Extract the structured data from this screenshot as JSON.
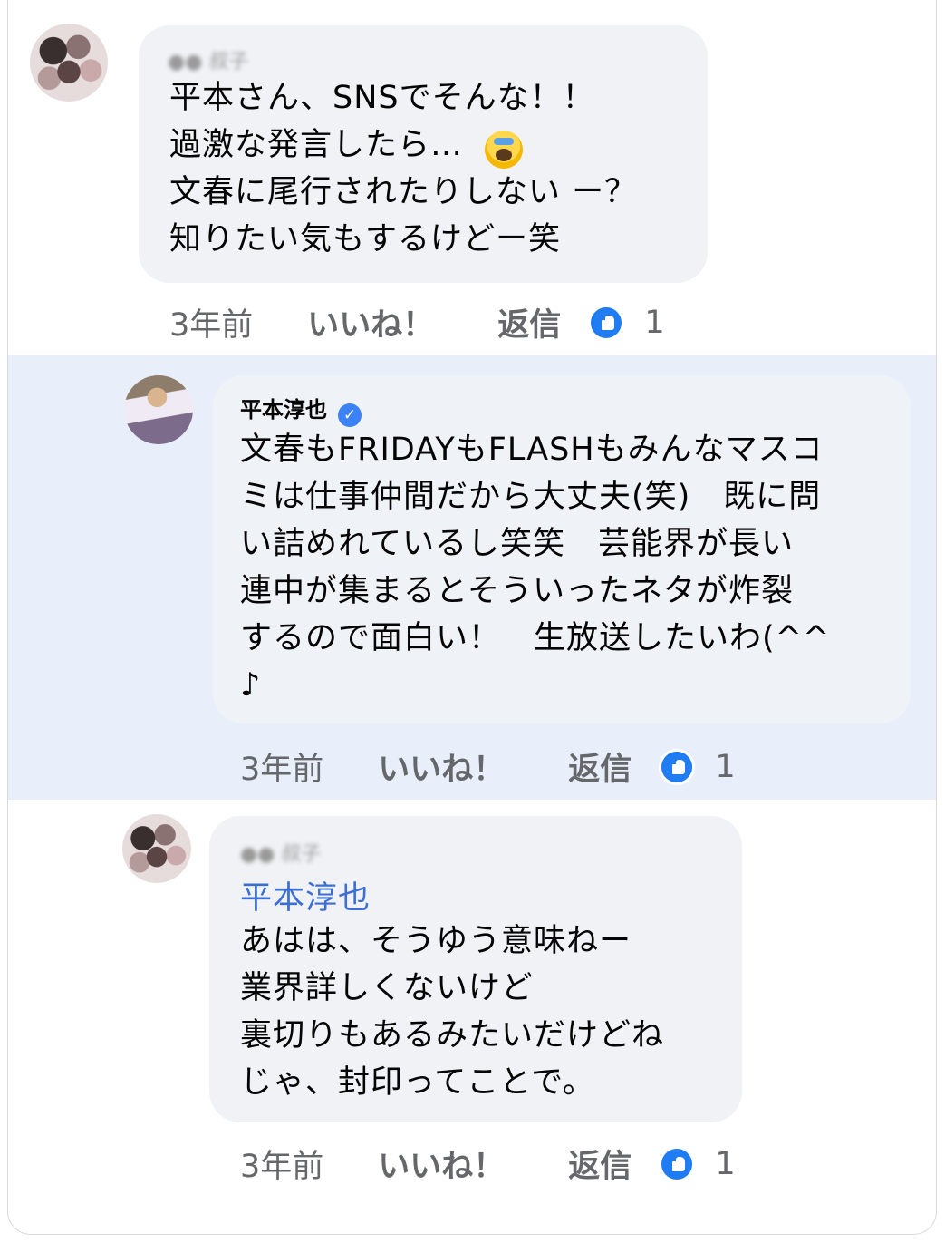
{
  "comments": [
    {
      "author": "●● 叔子",
      "text": "平本さん、SNSでそんな！！\n過激な発言したら…\n文春に尾行されたりしない ー？\n知りたい気もするけどー笑",
      "emoji": "face-screaming-in-fear",
      "time": "3年前",
      "like_label": "いいね！",
      "reply_label": "返信",
      "like_count": "1"
    },
    {
      "author": "平本淳也",
      "verified": true,
      "text": "文春もFRIDAYもFLASHもみんなマスコ\nミは仕事仲間だから大丈夫(笑)　既に問\nい詰めれているし笑笑　芸能界が長い\n連中が集まるとそういったネタが炸裂\nするので面白い！　生放送したいわ(^^\n♪",
      "time": "3年前",
      "like_label": "いいね！",
      "reply_label": "返信",
      "like_count": "1"
    },
    {
      "author": "●● 叔子",
      "mention": "平本淳也",
      "text": "あはは、そうゆう意味ねー\n業界詳しくないけど\n裏切りもあるみたいだけどね\nじゃ、封印ってことで。",
      "time": "3年前",
      "like_label": "いいね！",
      "reply_label": "返信",
      "like_count": "1"
    }
  ],
  "colors": {
    "highlight": "#e9effa",
    "bubble": "#f0f2f5",
    "mention": "#3b6fd6",
    "like_badge": "#1f7cf2",
    "verified": "#3b82f6"
  }
}
